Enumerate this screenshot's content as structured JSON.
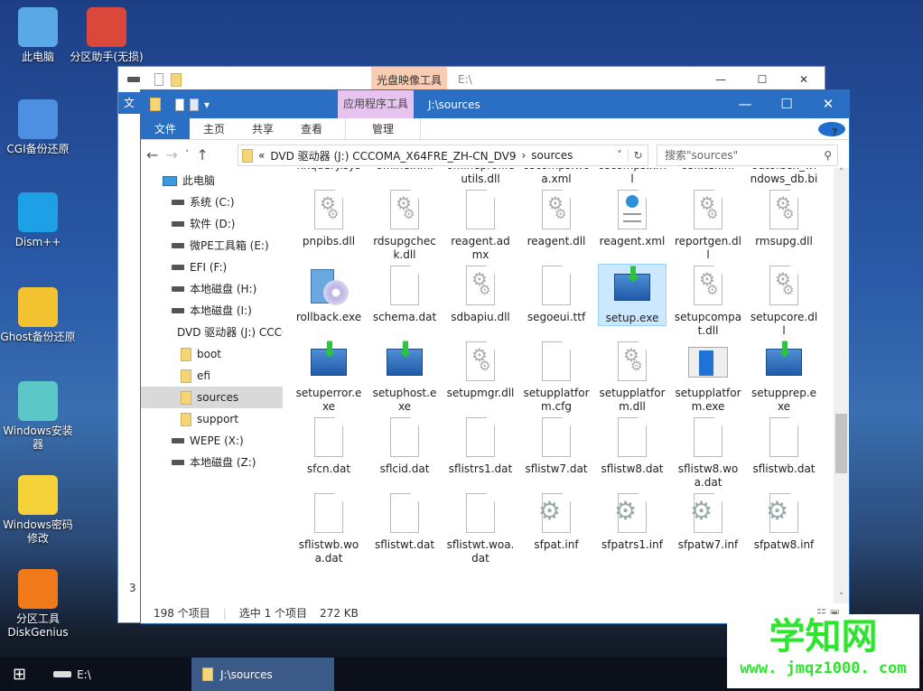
{
  "desktop": {
    "icons": [
      "此电脑",
      "分区助手(无损)",
      "CGI备份还原",
      "Dism++",
      "Ghost备份还原",
      "Windows安装器",
      "Windows密码修改",
      "分区工具DiskGenius"
    ]
  },
  "back_window": {
    "context_tab": "光盘映像工具",
    "title": "E:\\",
    "tab_fragment": "文",
    "status_fragment": "3"
  },
  "window": {
    "context_tab": "应用程序工具",
    "title": "J:\\sources",
    "ribbon": {
      "file": "文件",
      "home": "主页",
      "share": "共享",
      "view": "查看",
      "manage": "管理"
    },
    "address": {
      "prefix": "«",
      "path": "DVD 驱动器 (J:) CCCOMA_X64FRE_ZH-CN_DV9",
      "sep": "›",
      "current": "sources"
    },
    "search_placeholder": "搜索\"sources\"",
    "nav": [
      {
        "label": "此电脑",
        "t": "pc"
      },
      {
        "label": "系统 (C:)",
        "t": "drive"
      },
      {
        "label": "软件 (D:)",
        "t": "drive"
      },
      {
        "label": "微PE工具箱 (E:)",
        "t": "drive"
      },
      {
        "label": "EFI (F:)",
        "t": "drive"
      },
      {
        "label": "本地磁盘 (H:)",
        "t": "drive"
      },
      {
        "label": "本地磁盘 (I:)",
        "t": "drive"
      },
      {
        "label": "DVD 驱动器 (J:) CCCOMA",
        "t": "dvd"
      },
      {
        "label": "boot",
        "t": "folder"
      },
      {
        "label": "efi",
        "t": "folder"
      },
      {
        "label": "sources",
        "t": "folder",
        "selected": true
      },
      {
        "label": "support",
        "t": "folder"
      },
      {
        "label": "WEPE (X:)",
        "t": "drive"
      },
      {
        "label": "本地磁盘 (Z:)",
        "t": "drive"
      }
    ],
    "files": [
      {
        "n": "nxquery.sys",
        "t": "blank"
      },
      {
        "n": "offline.xml",
        "t": "blank"
      },
      {
        "n": "offlineprofileutils.dll",
        "t": "gear"
      },
      {
        "n": "oscomps.woa.xml",
        "t": "blank"
      },
      {
        "n": "oscomps.xml",
        "t": "blank"
      },
      {
        "n": "osfilter.inf",
        "t": "inf"
      },
      {
        "n": "outofbox_windows_db.bin",
        "t": "blank"
      },
      {
        "n": "pnpibs.dll",
        "t": "gear"
      },
      {
        "n": "rdsupgcheck.dll",
        "t": "gear"
      },
      {
        "n": "reagent.admx",
        "t": "blank"
      },
      {
        "n": "reagent.dll",
        "t": "gear"
      },
      {
        "n": "reagent.xml",
        "t": "xml"
      },
      {
        "n": "reportgen.dll",
        "t": "gear"
      },
      {
        "n": "rmsupg.dll",
        "t": "gear"
      },
      {
        "n": "rollback.exe",
        "t": "rollback"
      },
      {
        "n": "schema.dat",
        "t": "blank"
      },
      {
        "n": "sdbapiu.dll",
        "t": "gear"
      },
      {
        "n": "segoeui.ttf",
        "t": "blank"
      },
      {
        "n": "setup.exe",
        "t": "setup",
        "selected": true
      },
      {
        "n": "setupcompat.dll",
        "t": "gear"
      },
      {
        "n": "setupcore.dll",
        "t": "gear"
      },
      {
        "n": "setuperror.exe",
        "t": "setup"
      },
      {
        "n": "setuphost.exe",
        "t": "setup"
      },
      {
        "n": "setupmgr.dll",
        "t": "gear"
      },
      {
        "n": "setupplatform.cfg",
        "t": "blank"
      },
      {
        "n": "setupplatform.dll",
        "t": "gear"
      },
      {
        "n": "setupplatform.exe",
        "t": "app"
      },
      {
        "n": "setupprep.exe",
        "t": "setup"
      },
      {
        "n": "sfcn.dat",
        "t": "blank"
      },
      {
        "n": "sflcid.dat",
        "t": "blank"
      },
      {
        "n": "sflistrs1.dat",
        "t": "blank"
      },
      {
        "n": "sflistw7.dat",
        "t": "blank"
      },
      {
        "n": "sflistw8.dat",
        "t": "blank"
      },
      {
        "n": "sflistw8.woa.dat",
        "t": "blank"
      },
      {
        "n": "sflistwb.dat",
        "t": "blank"
      },
      {
        "n": "sflistwb.woa.dat",
        "t": "blank"
      },
      {
        "n": "sflistwt.dat",
        "t": "blank"
      },
      {
        "n": "sflistwt.woa.dat",
        "t": "blank"
      },
      {
        "n": "sfpat.inf",
        "t": "inf"
      },
      {
        "n": "sfpatrs1.inf",
        "t": "inf"
      },
      {
        "n": "sfpatw7.inf",
        "t": "inf"
      },
      {
        "n": "sfpatw8.inf",
        "t": "inf"
      }
    ],
    "status": {
      "count": "198 个项目",
      "selected": "选中 1 个项目",
      "size": "272 KB"
    }
  },
  "taskbar": {
    "drive_label": "E:\\",
    "active_window": "J:\\sources"
  },
  "watermark": {
    "title": "学知网",
    "url": "www. jmqz1000. com"
  }
}
